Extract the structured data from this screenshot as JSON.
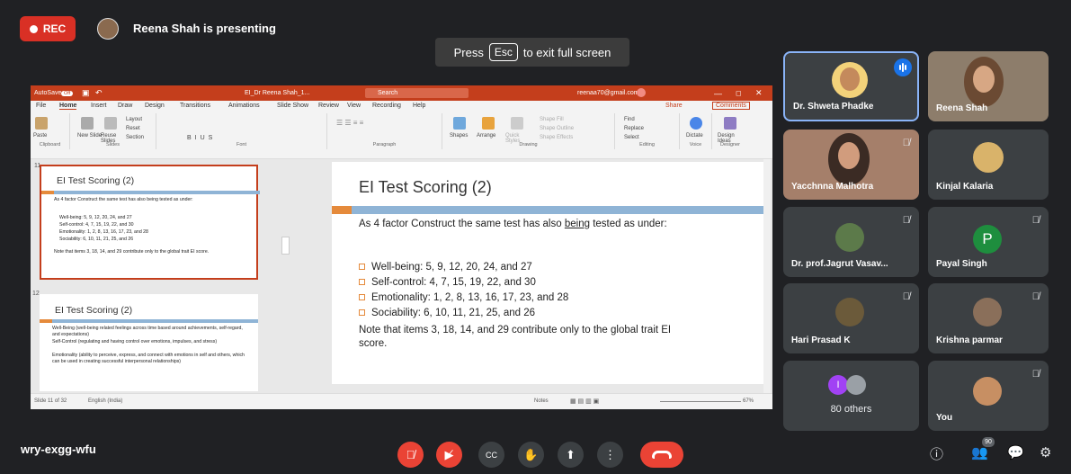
{
  "meeting": {
    "rec_label": "REC",
    "presenting_text": "Reena Shah is presenting",
    "fullscreen_press": "Press",
    "fullscreen_key": "Esc",
    "fullscreen_rest": "to exit full screen",
    "code": "wry-exgg-wfu"
  },
  "ppt": {
    "autosave": "AutoSave",
    "autosave_state": "Off",
    "doc_title": "EI_Dr Reena Shah_1...",
    "search": "Search",
    "account": "reenaa70@gmail.com",
    "menu": [
      "File",
      "Home",
      "Insert",
      "Draw",
      "Design",
      "Transitions",
      "Animations",
      "Slide Show",
      "Review",
      "View",
      "Recording",
      "Help"
    ],
    "share": "Share",
    "comments": "Comments",
    "ribbon_groups": [
      "Clipboard",
      "Slides",
      "Font",
      "Paragraph",
      "Drawing",
      "Editing",
      "Voice",
      "Designer"
    ],
    "ribbon_buttons": {
      "paste": "Paste",
      "new_slide": "New Slide",
      "reuse_slides": "Reuse Slides",
      "layout": "Layout",
      "reset": "Reset",
      "section": "Section",
      "shapes": "Shapes",
      "arrange": "Arrange",
      "quick_styles": "Quick Styles",
      "shape_fill": "Shape Fill",
      "shape_outline": "Shape Outline",
      "shape_effects": "Shape Effects",
      "find": "Find",
      "replace": "Replace",
      "select": "Select",
      "dictate": "Dictate",
      "design_ideas": "Design Ideas"
    },
    "thumbnails": [
      {
        "num": "11",
        "title": "EI Test Scoring (2)",
        "lines": [
          "As 4 factor Construct the same test has also being tested as under:",
          "Well-being: 5, 9, 12, 20, 24, and 27",
          "Self-control: 4, 7, 15, 19, 22, and 30",
          "Emotionality: 1, 2, 8, 13, 16, 17, 23, and 28",
          "Sociability: 6, 10, 11, 21, 25, and 26",
          "Note that items 3, 18, 14, and 29 contribute only to the global trait EI score."
        ]
      },
      {
        "num": "12",
        "title": "EI Test Scoring (2)",
        "lines": [
          "Well-Being (well-being related feelings across time based around achievements, self-regard, and expectations)",
          "Self-Control (regulating and having control over emotions, impulses, and stress)",
          "Emotionality (ability to perceive, express, and connect with emotions in self and others, which can be used in creating successful interpersonal relationships)"
        ]
      }
    ],
    "slide": {
      "title": "EI Test Scoring (2)",
      "intro_a": "As 4 factor Construct the same test has also",
      "intro_link": "being",
      "intro_b": "tested as under:",
      "bullets": [
        "Well-being: 5, 9, 12, 20, 24, and 27",
        "Self-control: 4, 7, 15, 19, 22, and 30",
        "Emotionality: 1, 2, 8, 13, 16, 17, 23, and 28",
        "Sociability: 6, 10, 11, 21, 25, and 26"
      ],
      "note": "Note that items 3, 18, 14, and 29 contribute only to the global trait EI score."
    },
    "status": {
      "slide_of": "Slide 11 of 32",
      "language": "English (India)",
      "notes": "Notes",
      "zoom": "67%"
    }
  },
  "participants": [
    {
      "name": "Dr. Shweta Phadke",
      "initial": "",
      "speaking": true,
      "muted": false
    },
    {
      "name": "Reena Shah",
      "initial": "",
      "speaking": false,
      "muted": false
    },
    {
      "name": "Yacchnna Malhotra",
      "initial": "",
      "speaking": false,
      "muted": true
    },
    {
      "name": "Kinjal Kalaria",
      "initial": "",
      "speaking": false,
      "muted": false
    },
    {
      "name": "Dr. prof.Jagrut Vasav...",
      "initial": "",
      "speaking": false,
      "muted": true
    },
    {
      "name": "Payal Singh",
      "initial": "P",
      "speaking": false,
      "muted": true
    },
    {
      "name": "Hari Prasad K",
      "initial": "",
      "speaking": false,
      "muted": true
    },
    {
      "name": "Krishna parmar",
      "initial": "",
      "speaking": false,
      "muted": true
    },
    {
      "name": "80 others",
      "initial": "I",
      "speaking": false,
      "muted": false
    },
    {
      "name": "You",
      "initial": "",
      "speaking": false,
      "muted": true
    }
  ],
  "people_count": "90",
  "colors": {
    "rec": "#d93025",
    "accent_blue": "#1a73e8",
    "ppt_red": "#c43e1c",
    "slide_rule": "#8fb4d6",
    "slide_accent": "#e58a3b",
    "payal_avatar": "#1e8e3e",
    "others_avatar": "#a142f4"
  },
  "icons": [
    "mic-off-icon",
    "camera-off-icon",
    "captions-icon",
    "raise-hand-icon",
    "present-icon",
    "more-options-icon",
    "end-call-icon",
    "info-icon",
    "people-icon",
    "chat-icon",
    "activities-icon"
  ]
}
